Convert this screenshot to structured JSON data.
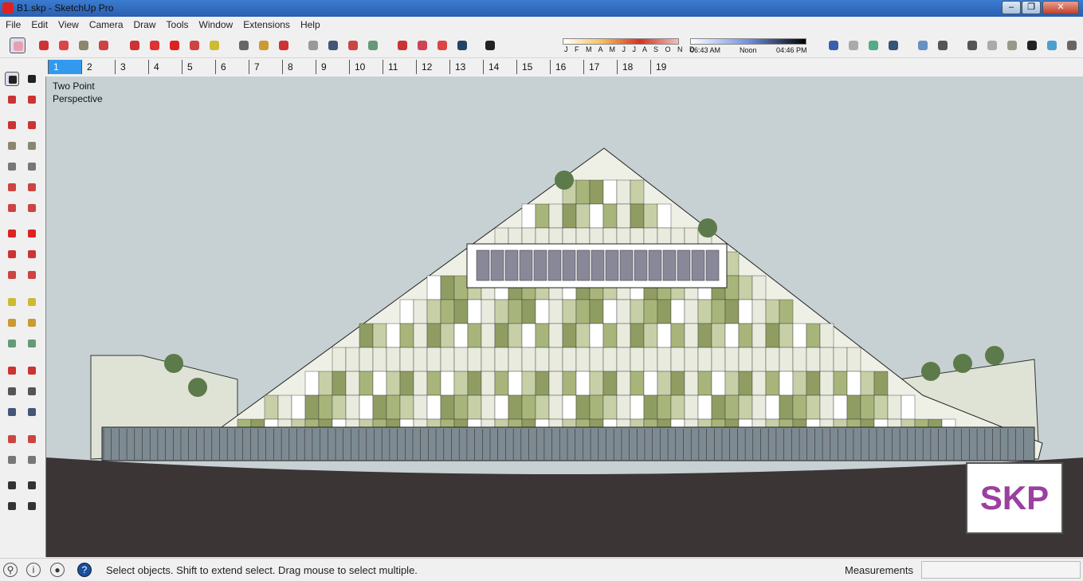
{
  "window": {
    "title": "B1.skp - SketchUp Pro",
    "min": "–",
    "max": "❐",
    "close": "✕"
  },
  "menu": [
    "File",
    "Edit",
    "View",
    "Camera",
    "Draw",
    "Tools",
    "Window",
    "Extensions",
    "Help"
  ],
  "shadows": {
    "months": "J F M A M J J A S O N D",
    "time_start": "06:43 AM",
    "time_mid": "Noon",
    "time_end": "04:46 PM",
    "date_fraction": 0.88,
    "time_fraction": 0.64
  },
  "scenes": [
    "1",
    "2",
    "3",
    "4",
    "5",
    "6",
    "7",
    "8",
    "9",
    "10",
    "11",
    "12",
    "13",
    "14",
    "15",
    "16",
    "17",
    "18",
    "19"
  ],
  "viewport": {
    "camera_label": "Two Point Perspective",
    "watermark": "SKP"
  },
  "status": {
    "message": "Select objects. Shift to extend select. Drag mouse to select multiple.",
    "measurements_label": "Measurements",
    "measurements_value": "",
    "help": "?"
  },
  "toolbar_icons": [
    "select",
    "eraser",
    "pencil",
    "arc",
    "rectangle",
    "push-pull",
    "follow-me",
    "move",
    "rotate",
    "scale",
    "tape-measure",
    "text",
    "paint-bucket",
    "orbit",
    "pan",
    "zoom",
    "zoom-extents",
    "add-location",
    "warehouse",
    "extension-warehouse",
    "layout",
    "section",
    "section-fill",
    "geo-location",
    "photo-textures",
    "add-scenery",
    "ground",
    "xray",
    "back-edges",
    "wireframe",
    "hidden-line",
    "shaded",
    "shaded-textures",
    "monochrome"
  ],
  "colors": {
    "accent": "#3399ee",
    "sky": "#c7d1d3",
    "ground": "#3b3536",
    "facade": "#a8b57a"
  }
}
